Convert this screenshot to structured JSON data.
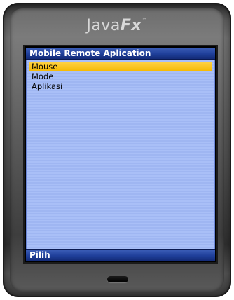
{
  "device": {
    "logo_prefix": "Java",
    "logo_fx": "Fx",
    "logo_mark": "™"
  },
  "screen": {
    "title": "Mobile Remote Aplication",
    "menu": [
      {
        "label": "Mouse",
        "selected": true
      },
      {
        "label": "Mode",
        "selected": false
      },
      {
        "label": "Aplikasi",
        "selected": false
      }
    ],
    "softkey_left": "Pilih"
  },
  "colors": {
    "titlebar": "#1f3f9a",
    "list_background": "#a9bff7",
    "selection": "#f5b800"
  }
}
